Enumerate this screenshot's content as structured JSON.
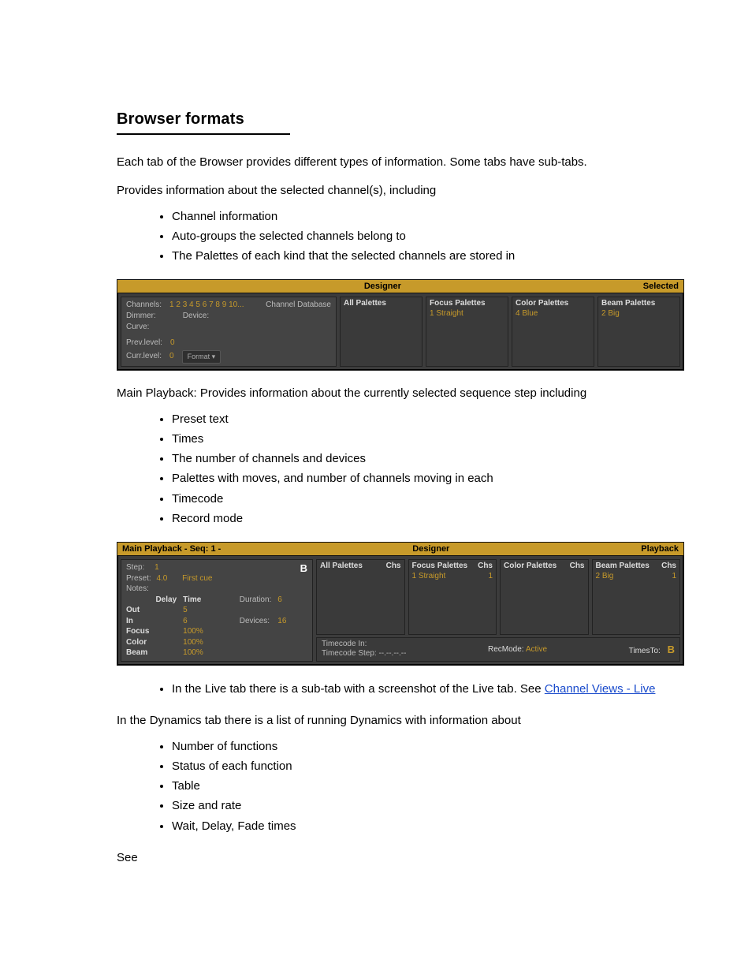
{
  "heading": "Browser formats",
  "intro": "Each tab of the Browser provides different types of information. Some tabs have sub-tabs.",
  "selected_intro": "Provides information about the selected channel(s), including",
  "selected_bullets": [
    "Channel information",
    "Auto-groups the selected channels belong to",
    "The Palettes of each kind that the selected channels are stored in"
  ],
  "panel1": {
    "header_center": "Designer",
    "header_right": "Selected",
    "channels_label": "Channels:",
    "channels_value": "1 2 3 4 5 6 7 8 9 10...",
    "channel_db": "Channel Database",
    "dimmer_label": "Dimmer:",
    "device_label": "Device:",
    "curve_label": "Curve:",
    "prev_label": "Prev.level:",
    "prev_val": "0",
    "curr_label": "Curr.level:",
    "curr_val": "0",
    "format_btn": "Format ▾",
    "pal_all": "All Palettes",
    "pal_focus": "Focus Palettes",
    "pal_focus_entry": "1 Straight",
    "pal_color": "Color Palettes",
    "pal_color_entry": "4 Blue",
    "pal_beam": "Beam Palettes",
    "pal_beam_entry": "2 Big"
  },
  "playback_intro": "Main Playback: Provides information about the currently selected sequence step including",
  "playback_bullets": [
    "Preset text",
    "Times",
    "The number of channels and devices",
    "Palettes with moves, and number of channels moving in each",
    "Timecode",
    "Record mode"
  ],
  "panel2": {
    "header_left": "Main Playback - Seq: 1 -",
    "header_center": "Designer",
    "header_right": "Playback",
    "step_label": "Step:",
    "step_val": "1",
    "preset_label": "Preset:",
    "preset_val": "4.0",
    "preset_text": "First cue",
    "notes_label": "Notes:",
    "b_indicator": "B",
    "delay_hdr": "Delay",
    "time_hdr": "Time",
    "duration_label": "Duration:",
    "duration_val": "6",
    "devices_label": "Devices:",
    "devices_val": "16",
    "out_label": "Out",
    "out_time": "5",
    "in_label": "In",
    "in_time": "6",
    "focus_label": "Focus",
    "focus_time": "100%",
    "color_label": "Color",
    "color_time": "100%",
    "beam_label": "Beam",
    "beam_time": "100%",
    "pal_all": "All Palettes",
    "chs": "Chs",
    "pal_focus": "Focus Palettes",
    "pal_focus_entry": "1 Straight",
    "pal_focus_chs": "1",
    "pal_color": "Color Palettes",
    "pal_beam": "Beam Palettes",
    "pal_beam_entry": "2 Big",
    "pal_beam_chs": "1",
    "tc_in": "Timecode In:",
    "tc_step": "Timecode Step:",
    "tc_step_val": "--.--.--.--",
    "rec_label": "RecMode:",
    "rec_val": "Active",
    "times_label": "TimesTo:",
    "times_val": "B"
  },
  "ll_sub_bullets": [
    "In the Live tab there is a sub-tab with a screenshot of the Live tab. See"
  ],
  "live_link": "Channel Views - Live",
  "ll_after": "In the Dynamics tab there is a list of running Dynamics with information about",
  "dyn_bullets": [
    "Number of functions",
    "Status of each function",
    "Table",
    "Size and rate",
    "Wait, Delay, Fade times"
  ],
  "see_label": "See "
}
